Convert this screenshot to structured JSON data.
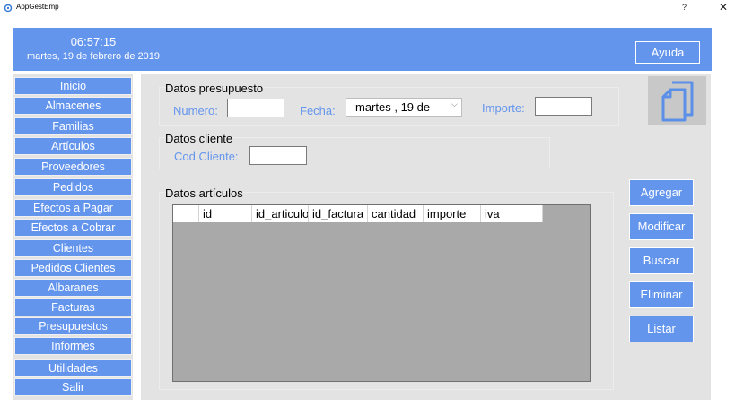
{
  "titlebar": {
    "title": "AppGestEmp",
    "help_glyph": "?",
    "close_glyph": "✕"
  },
  "header": {
    "time": "06:57:15",
    "date": "martes, 19 de febrero de 2019",
    "help_button": "Ayuda"
  },
  "colors": {
    "accent": "#6495ed",
    "panel": "#e3e3e3",
    "grid_bg": "#a9a9a9"
  },
  "sidebar": {
    "items": [
      {
        "label": "Inicio"
      },
      {
        "label": "Almacenes"
      },
      {
        "label": "Familias"
      },
      {
        "label": "Artículos"
      },
      {
        "label": "Proveedores"
      },
      {
        "label": "Pedidos"
      },
      {
        "label": "Efectos a Pagar"
      },
      {
        "label": "Efectos a Cobrar"
      },
      {
        "label": "Clientes"
      },
      {
        "label": "Pedidos Clientes"
      },
      {
        "label": "Albaranes"
      },
      {
        "label": "Facturas"
      },
      {
        "label": "Presupuestos"
      },
      {
        "label": "Informes"
      },
      {
        "label": "Utilidades"
      },
      {
        "label": "Salir"
      }
    ]
  },
  "presupuesto": {
    "group_title": "Datos presupuesto",
    "numero_label": "Numero:",
    "numero_value": "",
    "fecha_label": "Fecha:",
    "fecha_value": "martes  , 19 de",
    "importe_label": "Importe:",
    "importe_value": ""
  },
  "cliente": {
    "group_title": "Datos cliente",
    "cod_label": "Cod Cliente:",
    "cod_value": ""
  },
  "articulos": {
    "group_title": "Datos artículos",
    "columns": [
      "id",
      "id_articulo",
      "id_factura",
      "cantidad",
      "importe",
      "iva"
    ]
  },
  "actions": {
    "agregar": "Agregar",
    "modificar": "Modificar",
    "buscar": "Buscar",
    "eliminar": "Eliminar",
    "listar": "Listar"
  },
  "icons": {
    "app": "app-icon",
    "document": "document-icon",
    "dropdown": "chevron-down-icon"
  }
}
